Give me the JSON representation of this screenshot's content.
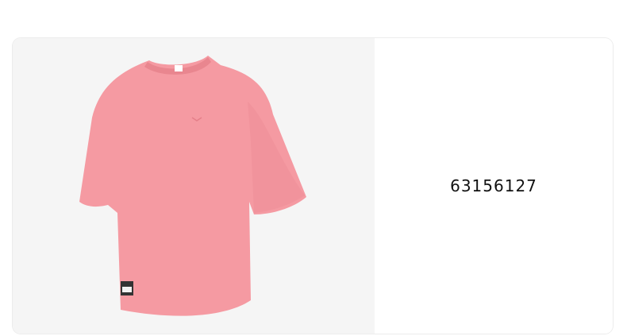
{
  "product": {
    "code": "63156127",
    "image_description_icon": "pink-oversized-tshirt-image",
    "colors": {
      "shirt": "#f59aa2",
      "shirt_shadow": "#e9868f",
      "background": "#f5f5f5"
    }
  }
}
